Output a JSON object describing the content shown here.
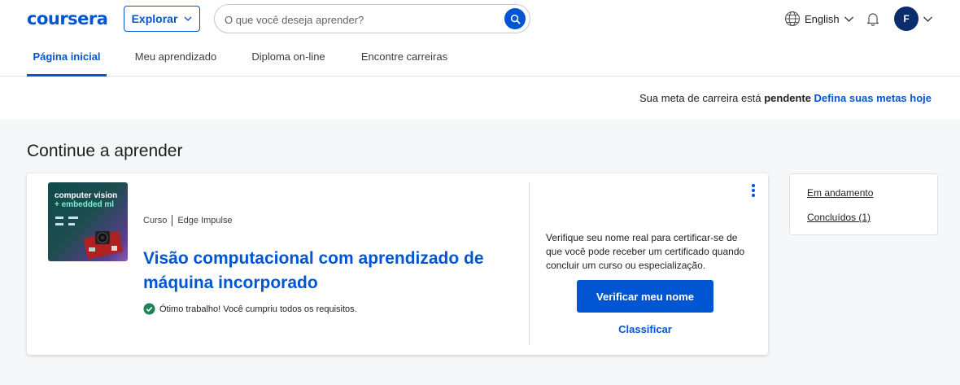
{
  "header": {
    "logo_text": "coursera",
    "explore_label": "Explorar",
    "search_placeholder": "O que você deseja aprender?",
    "language_label": "English",
    "avatar_initial": "F"
  },
  "tabs": [
    {
      "label": "Página inicial",
      "active": true
    },
    {
      "label": "Meu aprendizado",
      "active": false
    },
    {
      "label": "Diploma on-line",
      "active": false
    },
    {
      "label": "Encontre carreiras",
      "active": false
    }
  ],
  "goal_bar": {
    "text_prefix": "Sua meta de carreira está",
    "status": "pendente",
    "link": "Defina suas metas hoje"
  },
  "main": {
    "section_title": "Continue a aprender",
    "course": {
      "thumbnail_title": "computer vision",
      "thumbnail_subtitle": "+ embedded ml",
      "type": "Curso",
      "partner": "Edge Impulse",
      "title": "Visão computacional com aprendizado de máquina incorporado",
      "status": "Ótimo trabalho! Você cumpriu todos os requisitos.",
      "verify_text": "Verifique seu nome real para certificar-se de que você pode receber um certificado quando concluir um curso ou especialização.",
      "verify_button": "Verificar meu nome",
      "rate_link": "Classificar"
    },
    "filters": [
      {
        "label": "Em andamento"
      },
      {
        "label": "Concluídos (1)"
      }
    ]
  },
  "colors": {
    "brand": "#0056d2",
    "success": "#1f8354",
    "background": "#f5f7f8"
  }
}
